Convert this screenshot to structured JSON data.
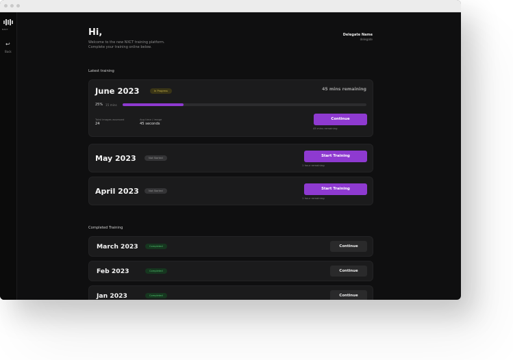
{
  "sidebar": {
    "logo_text": "NXCT",
    "back_label": "Back"
  },
  "header": {
    "greeting": "Hi,",
    "welcome_line1": "Welcome to the new NXCT training platform.",
    "welcome_line2": "Complete your training online below.",
    "delegate_name": "Delegate Name",
    "delegate_id": "delegate"
  },
  "latest": {
    "title": "Latest training",
    "items": [
      {
        "month": "June 2023",
        "status": "In Progress",
        "remaining": "45 mins remaining",
        "progress_percent": "25%",
        "progress_value": 0.25,
        "progress_mins": "15 mins",
        "stat1_label": "Total images assessed",
        "stat1_value": "24",
        "stat2_label": "Avg time / image",
        "stat2_value": "45 seconds",
        "button": "Continue",
        "button_sub": "45 mins remaining"
      },
      {
        "month": "May 2023",
        "status": "Not Started",
        "button": "Start Training",
        "button_sub": "1 hour remaining"
      },
      {
        "month": "April 2023",
        "status": "Not Started",
        "button": "Start Training",
        "button_sub": "1 hour remaining"
      }
    ]
  },
  "completed": {
    "title": "Completed Training",
    "items": [
      {
        "month": "March 2023",
        "status": "Completed",
        "button": "Continue"
      },
      {
        "month": "Feb 2023",
        "status": "Completed",
        "button": "Continue"
      },
      {
        "month": "Jan 2023",
        "status": "Completed",
        "button": "Continue"
      }
    ]
  },
  "colors": {
    "accent": "#8e3ad0",
    "background": "#0f0f10",
    "card": "#1b1b1c"
  }
}
